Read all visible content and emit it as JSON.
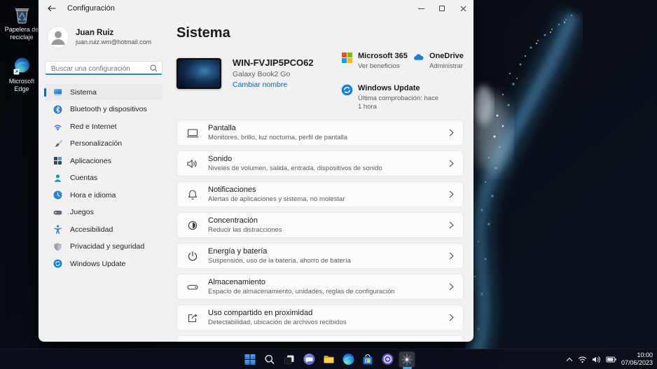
{
  "desktop": {
    "recycle_bin_label": "Papelera de reciclaje",
    "edge_label": "Microsoft Edge"
  },
  "titlebar": {
    "title": "Configuración"
  },
  "user": {
    "name": "Juan Ruiz",
    "email": "juan.ruiz.wm@hotmail.com"
  },
  "search": {
    "placeholder": "Buscar una configuración"
  },
  "nav": {
    "items": [
      {
        "label": "Sistema",
        "selected": true
      },
      {
        "label": "Bluetooth y dispositivos"
      },
      {
        "label": "Red e Internet"
      },
      {
        "label": "Personalización"
      },
      {
        "label": "Aplicaciones"
      },
      {
        "label": "Cuentas"
      },
      {
        "label": "Hora e idioma"
      },
      {
        "label": "Juegos"
      },
      {
        "label": "Accesibilidad"
      },
      {
        "label": "Privacidad y seguridad"
      },
      {
        "label": "Windows Update"
      }
    ]
  },
  "main": {
    "title": "Sistema",
    "device": {
      "name": "WIN-FVJIP5PCO62",
      "model": "Galaxy Book2 Go",
      "rename": "Cambiar nombre"
    },
    "quick": {
      "ms365": {
        "title": "Microsoft 365",
        "subtitle": "Ver beneficios"
      },
      "onedrive": {
        "title": "OneDrive",
        "subtitle": "Administrar"
      },
      "update": {
        "title": "Windows Update",
        "subtitle": "Última comprobación: hace 1 hora"
      }
    },
    "cards": [
      {
        "title": "Pantalla",
        "subtitle": "Monitores, brillo, luz nocturna, perfil de pantalla"
      },
      {
        "title": "Sonido",
        "subtitle": "Niveles de volumen, salida, entrada, dispositivos de sonido"
      },
      {
        "title": "Notificaciones",
        "subtitle": "Alertas de aplicaciones y sistema, no molestar"
      },
      {
        "title": "Concentración",
        "subtitle": "Reducir las distracciones"
      },
      {
        "title": "Energía y batería",
        "subtitle": "Suspensión, uso de la batería, ahorro de batería"
      },
      {
        "title": "Almacenamiento",
        "subtitle": "Espacio de almacenamiento, unidades, reglas de configuración"
      },
      {
        "title": "Uso compartido en proximidad",
        "subtitle": "Detectabilidad, ubicación de archivos recibidos"
      }
    ]
  },
  "taskbar": {
    "time": "10:00",
    "date": "07/06/2023"
  },
  "colors": {
    "accent": "#0067c0",
    "link": "#0066b4",
    "search_underline": "#2f8fa5"
  }
}
